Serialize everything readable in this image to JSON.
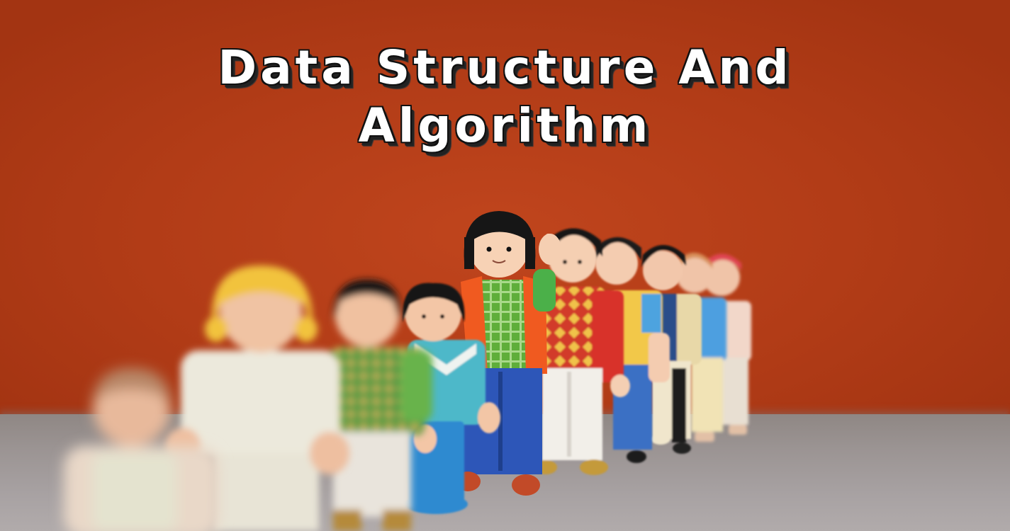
{
  "title": {
    "line1": "Data Structure And",
    "line2": "Algorithm"
  },
  "colors": {
    "wall": "#b63d18",
    "floor": "#9d9694",
    "title_text": "#ffffff",
    "title_outline": "#111111"
  }
}
